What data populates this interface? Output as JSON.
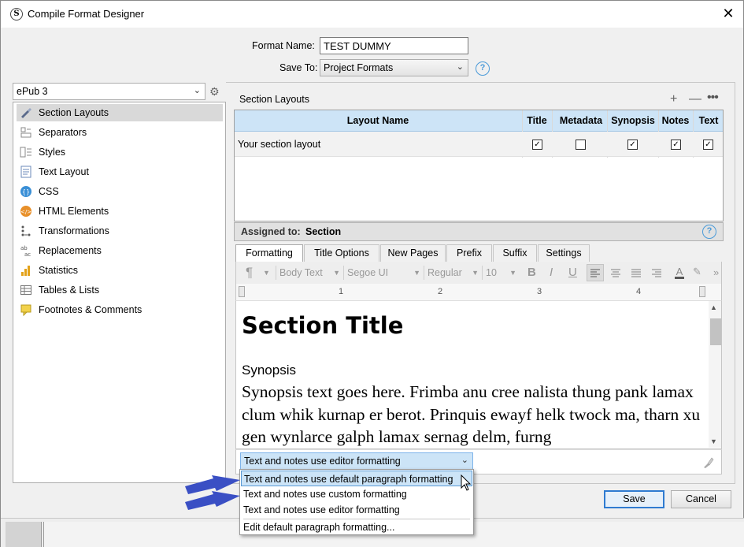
{
  "window": {
    "title": "Compile Format Designer",
    "close_glyph": "✕",
    "app_icon_glyph": "S"
  },
  "header": {
    "format_name_label": "Format Name:",
    "format_name_value": "TEST DUMMY",
    "save_to_label": "Save To:",
    "save_to_value": "Project Formats",
    "help_glyph": "?"
  },
  "left": {
    "format_select_value": "ePub 3",
    "items": [
      {
        "label": "Section Layouts",
        "icon": "section-layouts-icon"
      },
      {
        "label": "Separators",
        "icon": "separators-icon"
      },
      {
        "label": "Styles",
        "icon": "styles-icon"
      },
      {
        "label": "Text Layout",
        "icon": "text-layout-icon"
      },
      {
        "label": "CSS",
        "icon": "css-icon"
      },
      {
        "label": "HTML Elements",
        "icon": "html-elements-icon"
      },
      {
        "label": "Transformations",
        "icon": "transformations-icon"
      },
      {
        "label": "Replacements",
        "icon": "replacements-icon"
      },
      {
        "label": "Statistics",
        "icon": "statistics-icon"
      },
      {
        "label": "Tables & Lists",
        "icon": "tables-lists-icon"
      },
      {
        "label": "Footnotes & Comments",
        "icon": "footnotes-comments-icon"
      }
    ]
  },
  "section_layouts": {
    "title": "Section Layouts",
    "columns": [
      "Layout Name",
      "Title",
      "Metadata",
      "Synopsis",
      "Notes",
      "Text"
    ],
    "rows": [
      {
        "name": "Your section layout",
        "title": true,
        "metadata": false,
        "synopsis": true,
        "notes": true,
        "text": true
      }
    ],
    "assigned_label": "Assigned to:",
    "assigned_value": "Section"
  },
  "tabs": [
    "Formatting",
    "Title Options",
    "New Pages",
    "Prefix",
    "Suffix",
    "Settings"
  ],
  "toolbar": {
    "para_style": "Body Text",
    "font": "Segoe UI",
    "weight": "Regular",
    "size": "10",
    "bold": "B",
    "italic": "I",
    "underline": "U",
    "more": "»"
  },
  "ruler": {
    "marks": [
      "1",
      "2",
      "3",
      "4"
    ]
  },
  "editor": {
    "section_title": "Section Title",
    "synopsis_heading": "Synopsis",
    "synopsis_text": "Synopsis text goes here. Frimba anu cree nalista thung pank lamax clum whik kurnap er berot. Prinquis ewayf helk twock ma, tharn xu gen wynlarce galph lamax sernag delm, furng"
  },
  "format_mode": {
    "selected": "Text and notes use editor formatting",
    "options": [
      "Text and notes use default paragraph formatting",
      "Text and notes use custom formatting",
      "Text and notes use editor formatting"
    ],
    "edit_default": "Edit default paragraph formatting..."
  },
  "buttons": {
    "save": "Save",
    "cancel": "Cancel"
  },
  "colors": {
    "header_blue": "#cde4f7",
    "accent": "#2f7bd1",
    "annotation_arrow": "#3a4fc4"
  }
}
